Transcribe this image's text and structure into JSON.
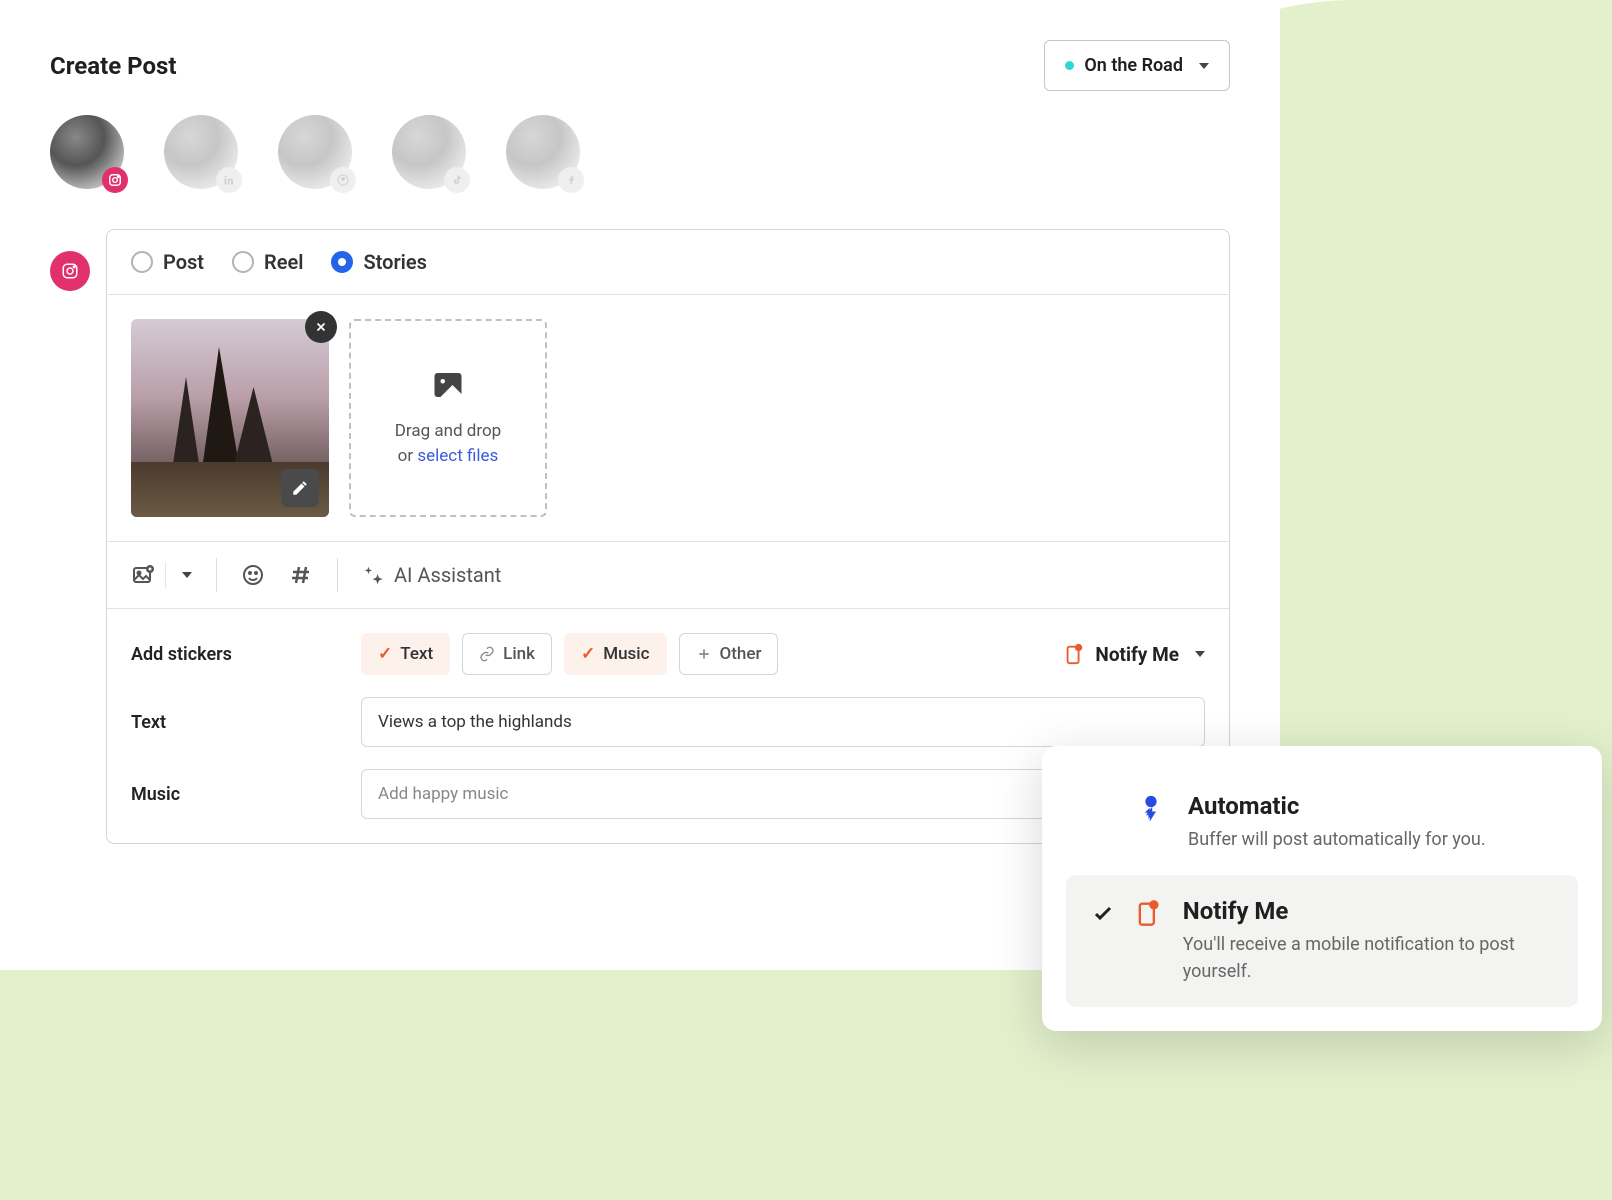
{
  "header": {
    "title": "Create Post",
    "workspace": "On the Road"
  },
  "avatars": [
    {
      "platform": "instagram",
      "active": true
    },
    {
      "platform": "linkedin",
      "active": false
    },
    {
      "platform": "pinterest",
      "active": false
    },
    {
      "platform": "tiktok",
      "active": false
    },
    {
      "platform": "facebook",
      "active": false
    }
  ],
  "tabs": {
    "post": "Post",
    "reel": "Reel",
    "stories": "Stories",
    "selected": "stories"
  },
  "dropzone": {
    "line1": "Drag and drop",
    "line2_prefix": "or ",
    "line2_link": "select files"
  },
  "toolbar": {
    "ai": "AI Assistant"
  },
  "stickers": {
    "label": "Add stickers",
    "text": "Text",
    "link": "Link",
    "music": "Music",
    "other": "Other"
  },
  "notify_trigger": "Notify Me",
  "fields": {
    "text_label": "Text",
    "text_value": "Views a top the highlands",
    "music_label": "Music",
    "music_placeholder": "Add happy music"
  },
  "popup": {
    "automatic": {
      "title": "Automatic",
      "desc": "Buffer will post automatically for you."
    },
    "notify": {
      "title": "Notify Me",
      "desc": "You'll receive a mobile notification to post yourself."
    }
  }
}
